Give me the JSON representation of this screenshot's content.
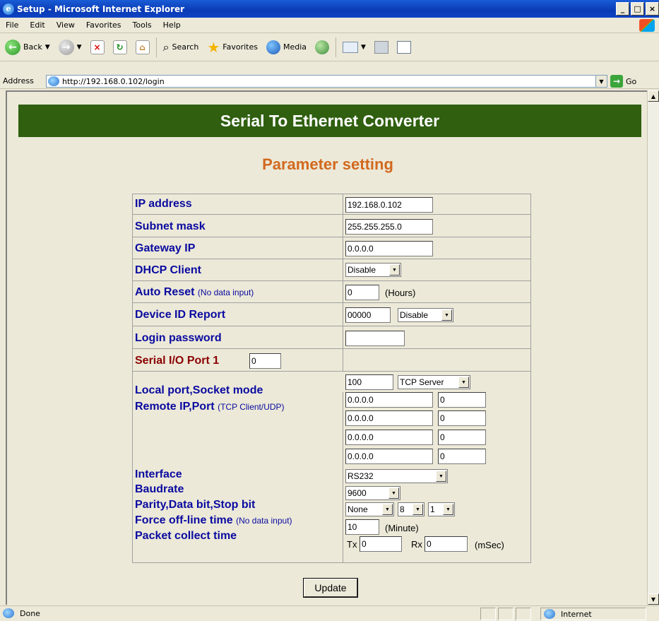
{
  "window": {
    "title": "Setup - Microsoft Internet Explorer"
  },
  "menu": [
    "File",
    "Edit",
    "View",
    "Favorites",
    "Tools",
    "Help"
  ],
  "toolbar": {
    "back": "Back",
    "search": "Search",
    "favorites": "Favorites",
    "media": "Media"
  },
  "address": {
    "label": "Address",
    "url": "http://192.168.0.102/login",
    "go": "Go"
  },
  "page": {
    "banner": "Serial To Ethernet Converter",
    "subtitle": "Parameter setting"
  },
  "fields": {
    "ip_label": "IP address",
    "ip_value": "192.168.0.102",
    "subnet_label": "Subnet mask",
    "subnet_value": "255.255.255.0",
    "gateway_label": "Gateway IP",
    "gateway_value": "0.0.0.0",
    "dhcp_label": "DHCP Client",
    "dhcp_value": "Disable",
    "autoreset_label": "Auto Reset",
    "autoreset_note": "(No data input)",
    "autoreset_value": "0",
    "autoreset_unit": "(Hours)",
    "devid_label": "Device ID Report",
    "devid_value": "00000",
    "devid_select": "Disable",
    "login_label": "Login password",
    "login_value": "",
    "port_label": "Serial I/O Port 1",
    "port_value": "0",
    "local_label": "Local port,Socket mode",
    "local_port": "100",
    "socket_mode": "TCP Server",
    "remote_label": "Remote IP,Port",
    "remote_note": "(TCP Client/UDP)",
    "remote": [
      {
        "ip": "0.0.0.0",
        "port": "0"
      },
      {
        "ip": "0.0.0.0",
        "port": "0"
      },
      {
        "ip": "0.0.0.0",
        "port": "0"
      },
      {
        "ip": "0.0.0.0",
        "port": "0"
      }
    ],
    "interface_label": "Interface",
    "interface_value": "RS232",
    "baud_label": "Baudrate",
    "baud_value": "9600",
    "parity_label": "Parity,Data bit,Stop bit",
    "parity_value": "None",
    "databit_value": "8",
    "stopbit_value": "1",
    "forceoff_label": "Force off-line time",
    "forceoff_note": "(No data input)",
    "forceoff_value": "10",
    "forceoff_unit": "(Minute)",
    "packet_label": "Packet collect time",
    "tx_label": "Tx",
    "tx_value": "0",
    "rx_label": "Rx",
    "rx_value": "0",
    "packet_unit": "(mSec)"
  },
  "update_button": "Update",
  "status": {
    "done": "Done",
    "zone": "Internet"
  }
}
